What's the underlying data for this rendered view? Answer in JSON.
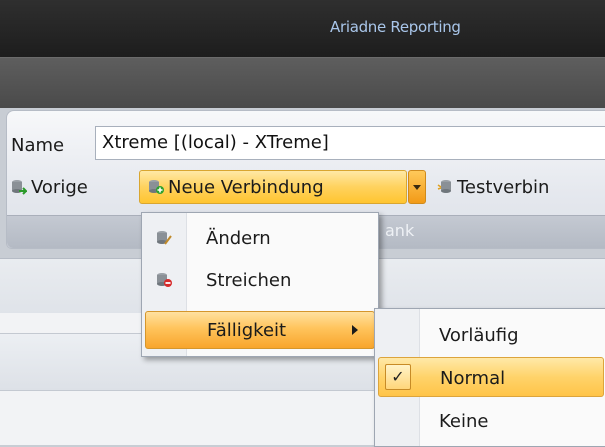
{
  "window": {
    "title": "Ariadne Reporting"
  },
  "ribbon": {
    "name_label": "Name",
    "name_value": "Xtreme [(local) - XTreme]",
    "buttons": {
      "previous": "Vorige",
      "new_connection": "Neue Verbindung",
      "test_connection": "Testverbin"
    },
    "group_caption": "ank"
  },
  "context_menu": {
    "items": [
      {
        "label": "Ändern",
        "icon": "db-edit-icon"
      },
      {
        "label": "Streichen",
        "icon": "db-delete-icon"
      },
      {
        "label": "Fälligkeit",
        "icon": "",
        "has_submenu": true
      }
    ]
  },
  "submenu": {
    "items": [
      {
        "label": "Vorläufig",
        "checked": false
      },
      {
        "label": "Normal",
        "checked": true
      },
      {
        "label": "Keine",
        "checked": false
      }
    ],
    "check_glyph": "✓"
  },
  "colors": {
    "highlight": "#ffc45c",
    "title_text": "#a9c6ea"
  }
}
